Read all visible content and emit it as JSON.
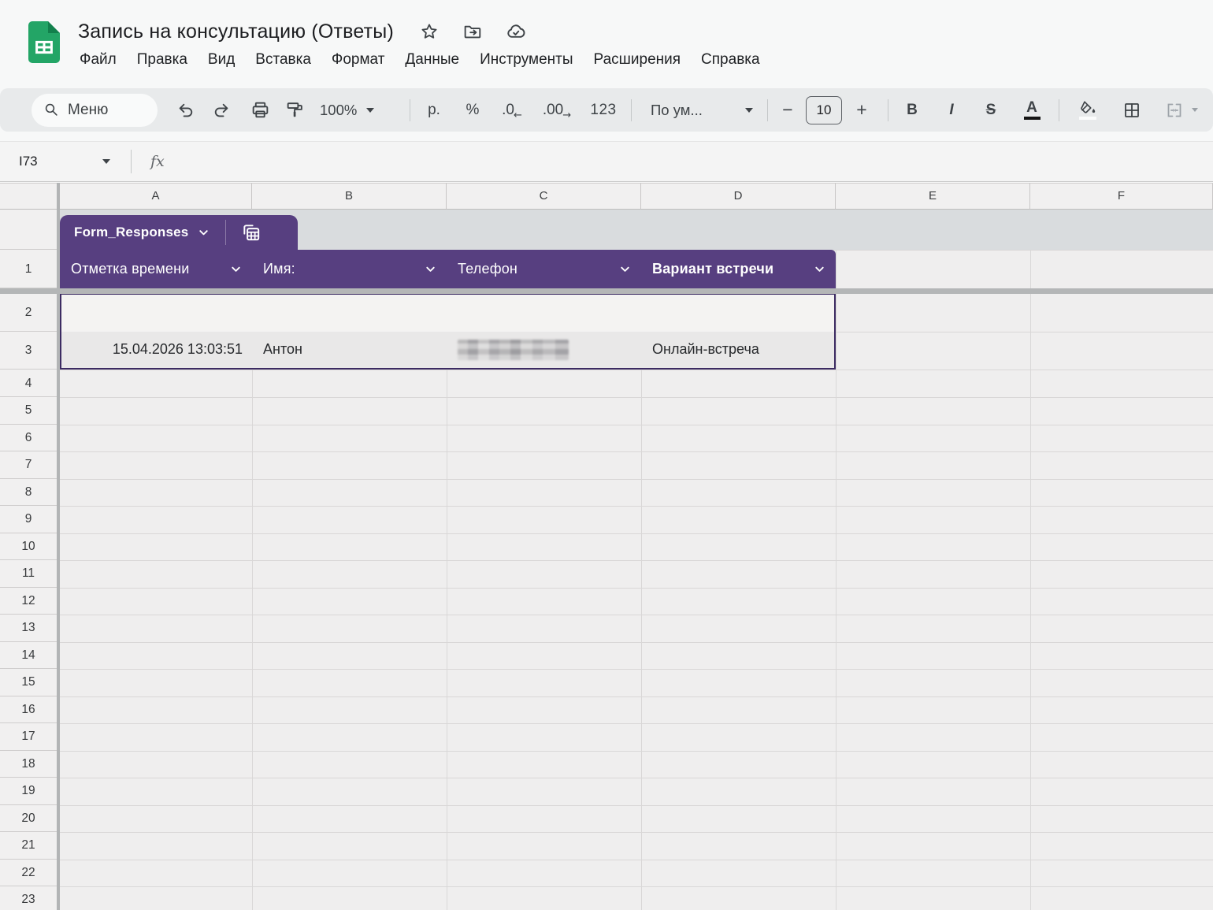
{
  "app": {
    "brand_green": "#23a566",
    "accent_purple": "#573f80",
    "table_border_purple": "#3c2b62",
    "band_light": "#f4f3f2",
    "band_dark": "#e9e8e8"
  },
  "titlebar": {
    "title": "Запись на консультацию (Ответы)",
    "status_icons": [
      "star-icon",
      "move-to-folder-icon",
      "cloud-saved-icon"
    ],
    "menus": [
      "Файл",
      "Правка",
      "Вид",
      "Вставка",
      "Формат",
      "Данные",
      "Инструменты",
      "Расширения",
      "Справка"
    ]
  },
  "toolbar": {
    "search_label": "Меню",
    "zoom_value": "100%",
    "format_currency": "р.",
    "format_percent": "%",
    "format_decrease_decimal": ".0",
    "format_decrease_arrow": "←",
    "format_increase_decimal": ".00",
    "format_increase_arrow": "→",
    "format_more": "123",
    "font_name": "По ум...",
    "font_size": "10",
    "minus_label": "−",
    "plus_label": "+",
    "bold_label": "B",
    "italic_label": "I",
    "strikethrough_label": "S",
    "text_color_label": "A"
  },
  "formula_bar": {
    "name_box_value": "I73",
    "fx_label": "fx"
  },
  "sheet": {
    "column_letters": [
      "A",
      "B",
      "C",
      "D",
      "E",
      "F"
    ],
    "visible_row_count": 23,
    "table": {
      "name": "Form_Responses",
      "tab_icon": "table-view-icon",
      "columns": [
        "Отметка времени",
        "Имя:",
        "Телефон",
        "Вариант встречи"
      ],
      "rows": [
        {
          "timestamp": "",
          "name": "",
          "phone": "",
          "meeting": ""
        },
        {
          "timestamp": "15.04.2026 13:03:51",
          "name": "Антон",
          "phone": "",
          "phone_redacted": true,
          "meeting": "Онлайн-встреча"
        }
      ]
    }
  }
}
